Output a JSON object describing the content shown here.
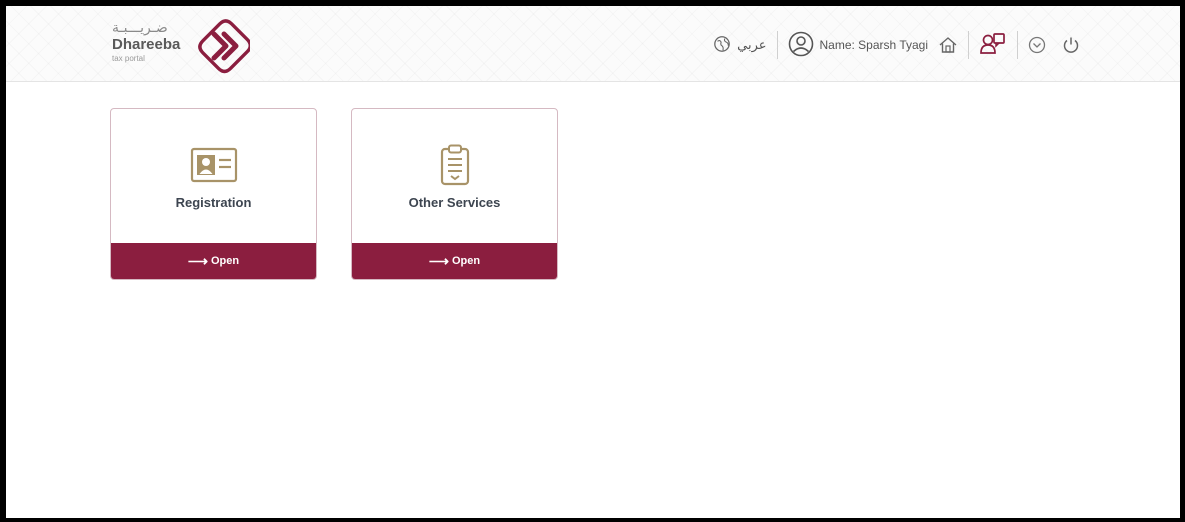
{
  "header": {
    "logo": {
      "arabic": "ضـريـــبـة",
      "name": "Dhareeba",
      "sub": "tax portal"
    },
    "language_label": "عربي",
    "user_label": "Name: Sparsh Tyagi",
    "icons": [
      "globe-icon",
      "user-circle-icon",
      "home-icon",
      "users-icon",
      "chevron-down-circle-icon",
      "power-icon"
    ]
  },
  "cards": [
    {
      "title": "Registration",
      "action_label": "Open",
      "icon": "id-card-icon"
    },
    {
      "title": "Other Services",
      "action_label": "Open",
      "icon": "clipboard-icon"
    }
  ],
  "colors": {
    "brand": "#8b1e3f",
    "icon_gold": "#a89368",
    "card_title": "#3d4550"
  }
}
